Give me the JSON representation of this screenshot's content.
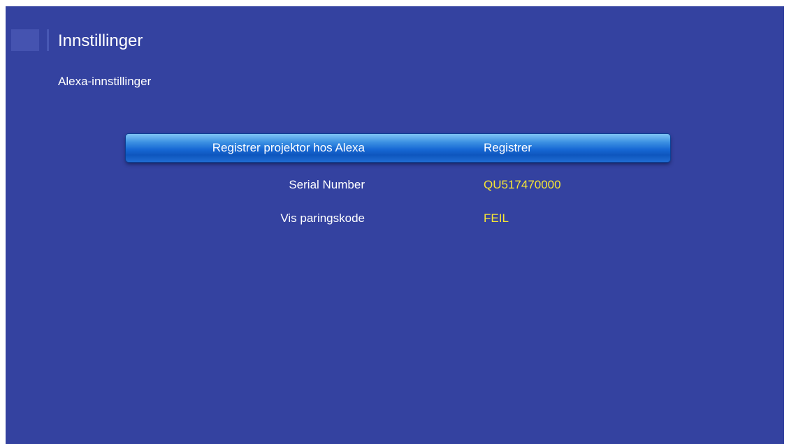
{
  "header": {
    "icon": "settings-icon",
    "title": "Innstillinger"
  },
  "page": {
    "subtitle": "Alexa-innstillinger"
  },
  "menu": {
    "items": [
      {
        "label": "Registrer projektor hos Alexa",
        "value": "Registrer",
        "selected": true
      },
      {
        "label": "Serial Number",
        "value": "QU517470000",
        "selected": false
      },
      {
        "label": "Vis paringskode",
        "value": "FEIL",
        "selected": false
      }
    ]
  },
  "colors": {
    "background": "#3442a0",
    "highlight": "#1768d4",
    "value_text": "#f8e634",
    "text": "#ffffff"
  }
}
